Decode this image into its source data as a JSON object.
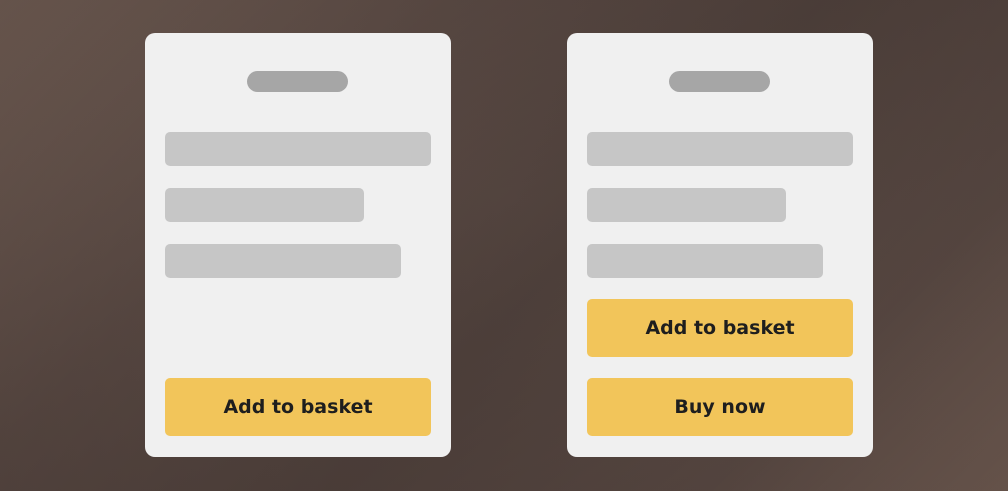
{
  "cards": [
    {
      "buttons": [
        {
          "label": "Add to basket"
        }
      ]
    },
    {
      "buttons": [
        {
          "label": "Add to basket"
        },
        {
          "label": "Buy now"
        }
      ]
    }
  ],
  "colors": {
    "card_background": "#f0f0f0",
    "placeholder_handle": "#a6a6a6",
    "placeholder_bar": "#c6c6c6",
    "button_background": "#f2c55a",
    "button_text": "#1e1e1e"
  }
}
